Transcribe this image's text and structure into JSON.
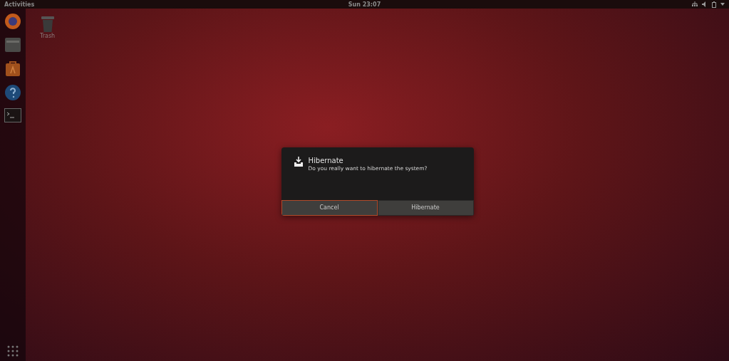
{
  "top_bar": {
    "activities": "Activities",
    "clock": "Sun 23:07"
  },
  "dock": {
    "apps": [
      {
        "kind": "browser"
      },
      {
        "kind": "files"
      },
      {
        "kind": "software"
      },
      {
        "kind": "help"
      },
      {
        "kind": "terminal"
      }
    ]
  },
  "desktop": {
    "icons": [
      {
        "label": "Trash"
      }
    ]
  },
  "dialog": {
    "title": "Hibernate",
    "message": "Do you really want to hibernate the system?",
    "buttons": [
      {
        "label": "Cancel",
        "selected": true
      },
      {
        "label": "Hibernate",
        "selected": false
      }
    ]
  }
}
